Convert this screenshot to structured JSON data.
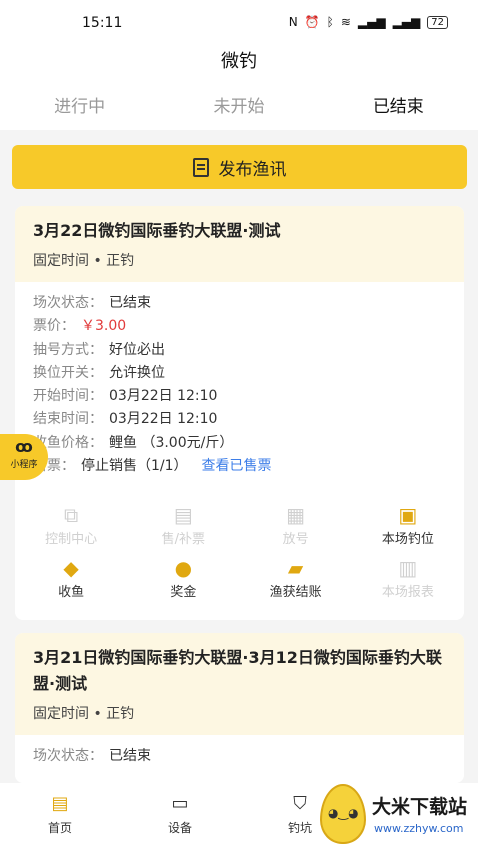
{
  "status_bar": {
    "time": "15:11",
    "battery": "72",
    "icons": [
      "nfc-icon",
      "alarm-icon",
      "bluetooth-icon",
      "wifi-icon",
      "signal-icon",
      "signal-icon"
    ]
  },
  "header": {
    "title": "微钓"
  },
  "tabs": [
    {
      "label": "进行中",
      "active": false
    },
    {
      "label": "未开始",
      "active": false
    },
    {
      "label": "已结束",
      "active": true
    }
  ],
  "publish_button": {
    "label": "发布渔讯",
    "icon": "document-icon"
  },
  "cards": [
    {
      "title": "3月22日微钓国际垂钓大联盟·测试",
      "subtitle": "固定时间 • 正钓",
      "rows": [
        {
          "label": "场次状态：",
          "value": "已结束"
        },
        {
          "label": "票价：",
          "value": "￥3.00"
        },
        {
          "label": "抽号方式：",
          "value": "好位必出"
        },
        {
          "label": "换位开关：",
          "value": "允许换位"
        },
        {
          "label": "开始时间：",
          "value": "03月22日 12:10"
        },
        {
          "label": "结束时间：",
          "value": "03月22日 12:10"
        },
        {
          "label": "收鱼价格：",
          "value": "鲤鱼 （3.00元/斤）"
        },
        {
          "label": "售票：",
          "value": "停止销售（1/1）",
          "link": "查看已售票"
        }
      ],
      "actions": [
        {
          "label": "控制中心",
          "icon": "control-center-icon",
          "enabled": false
        },
        {
          "label": "售/补票",
          "icon": "ticket-machine-icon",
          "enabled": false
        },
        {
          "label": "放号",
          "icon": "number-release-icon",
          "enabled": false
        },
        {
          "label": "本场钓位",
          "icon": "fishing-spot-icon",
          "enabled": true
        },
        {
          "label": "收鱼",
          "icon": "fish-icon",
          "enabled": true
        },
        {
          "label": "奖金",
          "icon": "money-bag-icon",
          "enabled": true
        },
        {
          "label": "渔获结账",
          "icon": "wallet-icon",
          "enabled": true
        },
        {
          "label": "本场报表",
          "icon": "report-icon",
          "enabled": false
        }
      ]
    },
    {
      "title": "3月21日微钓国际垂钓大联盟·3月12日微钓国际垂钓大联盟·测试",
      "subtitle": "固定时间 • 正钓",
      "rows": [
        {
          "label": "场次状态：",
          "value": "已结束"
        }
      ]
    }
  ],
  "mini_program": {
    "label": "小程序",
    "icon": "mini-program-icon"
  },
  "tabbar": [
    {
      "label": "首页",
      "icon": "home-icon",
      "active": true
    },
    {
      "label": "设备",
      "icon": "device-icon",
      "active": false
    },
    {
      "label": "钓坑",
      "icon": "fishing-pond-icon",
      "active": false
    }
  ],
  "watermark": {
    "title": "大米下载站",
    "url": "www.zzhyw.com"
  },
  "colors": {
    "accent": "#f7c929",
    "price": "#e23a3a",
    "link": "#3d7ee8",
    "card_head": "#fdf7e2"
  }
}
